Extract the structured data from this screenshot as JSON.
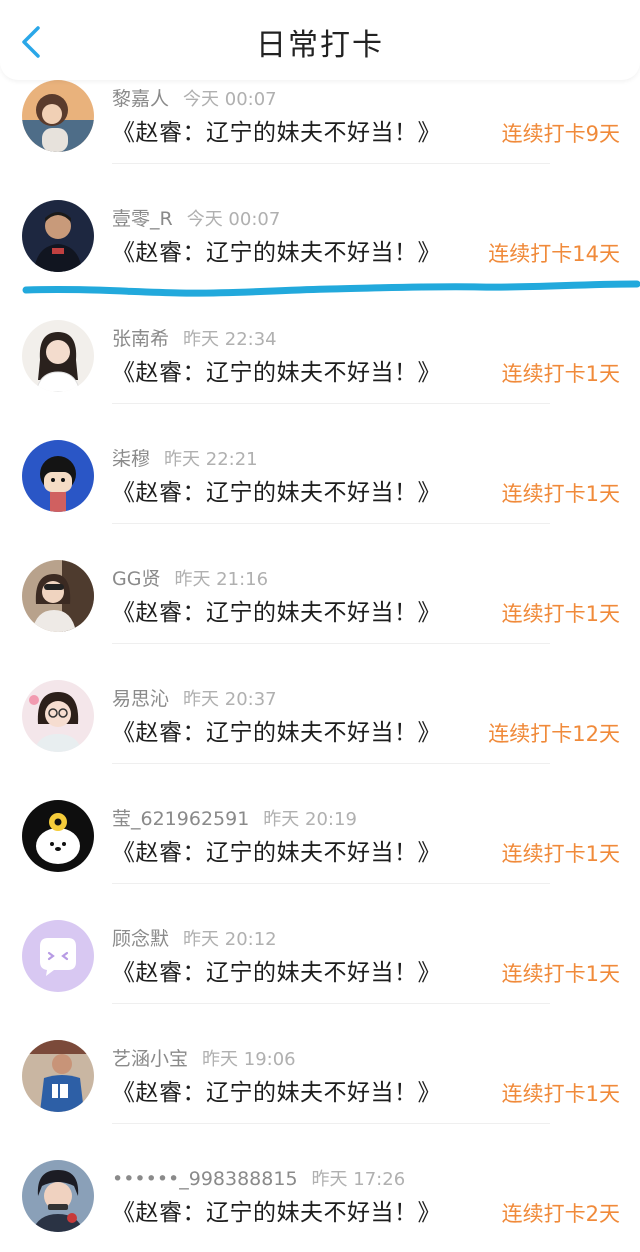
{
  "header": {
    "title": "日常打卡",
    "back_icon": "chevron-left-icon",
    "back_color": "#2aa7e8"
  },
  "colors": {
    "streak": "#f08a3a",
    "annotation_line": "#22a9dc"
  },
  "items": [
    {
      "name": "黎嘉人",
      "time": "今天 00:07",
      "content": "《赵睿：辽宁的妹夫不好当！》",
      "streak": "连续打卡9天"
    },
    {
      "name": "壹零_R",
      "time": "今天 00:07",
      "content": "《赵睿：辽宁的妹夫不好当！》",
      "streak": "连续打卡14天"
    },
    {
      "name": "张南希",
      "time": "昨天 22:34",
      "content": "《赵睿：辽宁的妹夫不好当！》",
      "streak": "连续打卡1天"
    },
    {
      "name": "柒穆",
      "time": "昨天 22:21",
      "content": "《赵睿：辽宁的妹夫不好当！》",
      "streak": "连续打卡1天"
    },
    {
      "name": "GG贤",
      "time": "昨天 21:16",
      "content": "《赵睿：辽宁的妹夫不好当！》",
      "streak": "连续打卡1天"
    },
    {
      "name": "易思沁",
      "time": "昨天 20:37",
      "content": "《赵睿：辽宁的妹夫不好当！》",
      "streak": "连续打卡12天"
    },
    {
      "name": "莹_621962591",
      "time": "昨天 20:19",
      "content": "《赵睿：辽宁的妹夫不好当！》",
      "streak": "连续打卡1天"
    },
    {
      "name": "顾念默",
      "time": "昨天 20:12",
      "content": "《赵睿：辽宁的妹夫不好当！》",
      "streak": "连续打卡1天"
    },
    {
      "name": "艺涵小宝",
      "time": "昨天 19:06",
      "content": "《赵睿：辽宁的妹夫不好当！》",
      "streak": "连续打卡1天"
    },
    {
      "name": "••••••_998388815",
      "time": "昨天 17:26",
      "content": "《赵睿：辽宁的妹夫不好当！》",
      "streak": "连续打卡2天"
    }
  ]
}
